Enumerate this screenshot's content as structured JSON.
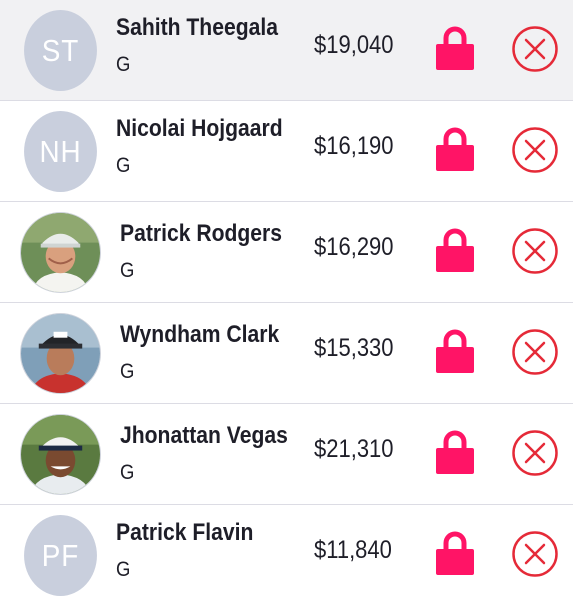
{
  "theme": {
    "accent": "#ff1466",
    "remove_color": "#e52a38",
    "avatar_placeholder": "#c9cfdd",
    "selected_row_bg": "#f1f1f3"
  },
  "players": [
    {
      "initials": "ST",
      "name": "Sahith Theegala",
      "position": "G",
      "salary": "$19,040",
      "selected": true,
      "lock_icon": "lock-icon",
      "remove_icon": "circle-x-icon"
    },
    {
      "initials": "NH",
      "name": "Nicolai Hojgaard",
      "position": "G",
      "salary": "$16,190",
      "lock_icon": "lock-icon",
      "remove_icon": "circle-x-icon"
    },
    {
      "name": "Patrick Rodgers",
      "position": "G",
      "salary": "$16,290",
      "lock_icon": "lock-icon",
      "remove_icon": "circle-x-icon"
    },
    {
      "name": "Wyndham Clark",
      "position": "G",
      "salary": "$15,330",
      "lock_icon": "lock-icon",
      "remove_icon": "circle-x-icon"
    },
    {
      "name": "Jhonattan Vegas",
      "position": "G",
      "salary": "$21,310",
      "lock_icon": "lock-icon",
      "remove_icon": "circle-x-icon"
    },
    {
      "initials": "PF",
      "name": "Patrick Flavin",
      "position": "G",
      "salary": "$11,840",
      "lock_icon": "lock-icon",
      "remove_icon": "circle-x-icon"
    }
  ]
}
